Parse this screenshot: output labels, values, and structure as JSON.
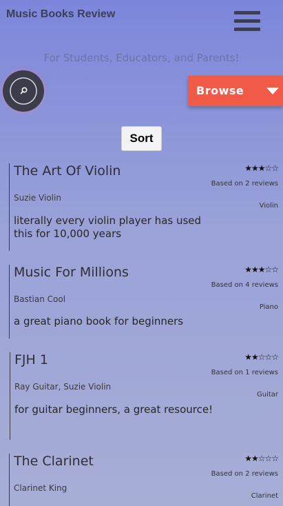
{
  "header": {
    "site_title": "Music Books Review",
    "tagline": "For Students, Educators, and Parents!"
  },
  "icons": {
    "menu": "hamburger-menu-icon",
    "search": "magnifying-glass-icon",
    "browse_caret": "caret-down-icon",
    "rating": "star-icon"
  },
  "colors": {
    "background_top": "#7c86db",
    "background_bottom": "#a7aed6",
    "browse_button": "#f25a48",
    "search_button": "#3b3d4a",
    "menu_icon": "#3b3e5b"
  },
  "controls": {
    "browse_label": "Browse",
    "sort_label": "Sort"
  },
  "reviews": [
    {
      "title": "The Art Of Violin",
      "author": "Suzie Violin",
      "summary": "literally every violin player has used this for 10,000 years",
      "rating": 3,
      "rating_max": 5,
      "stars": "★★★☆☆",
      "review_count": "Based on 2 reviews",
      "instrument": "Violin"
    },
    {
      "title": "Music For Millions",
      "author": "Bastian Cool",
      "summary": "a great piano book for beginners",
      "rating": 3,
      "rating_max": 5,
      "stars": "★★★☆☆",
      "review_count": "Based on 4 reviews",
      "instrument": "Piano"
    },
    {
      "title": "FJH 1",
      "author": "Ray Guitar, Suzie Violin",
      "summary": "for guitar beginners, a great resource!",
      "rating": 2,
      "rating_max": 5,
      "stars": "★★☆☆☆",
      "review_count": "Based on 1 reviews",
      "instrument": "Guitar"
    },
    {
      "title": "The Clarinet",
      "author": "Clarinet King",
      "summary": "",
      "rating": 2,
      "rating_max": 5,
      "stars": "★★☆☆☆",
      "review_count": "Based on 2 reviews",
      "instrument": "Clarinet"
    }
  ]
}
